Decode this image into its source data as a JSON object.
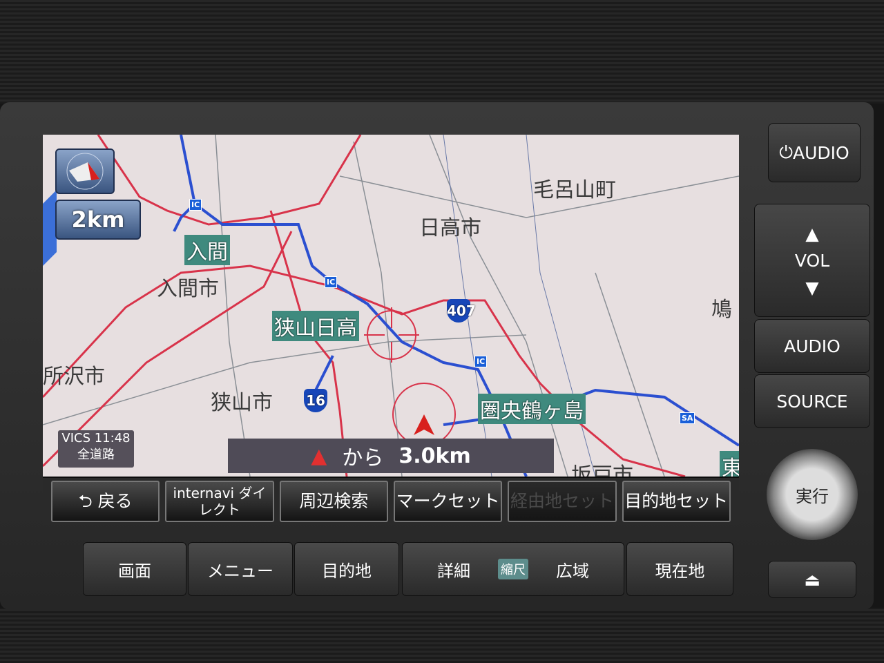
{
  "map": {
    "scale": "2km",
    "vics": {
      "line1": "VICS 11:48",
      "line2": "全道路"
    },
    "distance": {
      "from": "から",
      "value": "3.0km"
    },
    "places": [
      "毛呂山町",
      "日高市",
      "入間市",
      "所沢市",
      "狭山市",
      "坂戸市",
      "鳩",
      "東"
    ],
    "ic_labels": [
      "入間",
      "狭山日高",
      "圏央鶴ヶ島"
    ],
    "routes": [
      "407",
      "16"
    ],
    "ic_badge": "IC",
    "sa_badge": "SA"
  },
  "softkeys": [
    {
      "label": "戻る",
      "icon": "back-arrow-icon"
    },
    {
      "label": "internavi ダイレクト"
    },
    {
      "label": "周辺検索"
    },
    {
      "label": "マークセット"
    },
    {
      "label": "経由地セット",
      "disabled": true
    },
    {
      "label": "目的地セット"
    }
  ],
  "hardkeys": {
    "screen": "画面",
    "menu": "メニュー",
    "destination": "目的地",
    "detail": "詳細",
    "scale": "縮尺",
    "wide": "広域",
    "current": "現在地"
  },
  "side": {
    "audio_power": "AUDIO",
    "vol": "VOL",
    "audio": "AUDIO",
    "source": "SOURCE",
    "enter": "実行"
  },
  "colors": {
    "major_road": "#d8334a",
    "highway": "#2b4fd0",
    "map_bg": "#e7dfe0",
    "label_bg": "#3f8a7e"
  }
}
